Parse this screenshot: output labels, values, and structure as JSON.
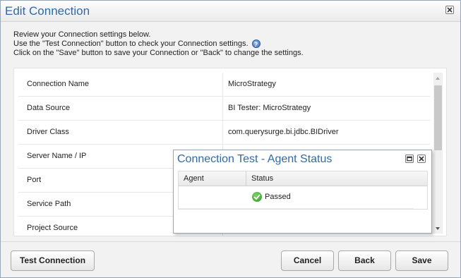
{
  "dialog": {
    "title": "Edit Connection",
    "intro": {
      "line1": "Review your Connection settings below.",
      "line2": "Use the \"Test Connection\" button to check your Connection settings.",
      "line3": "Click on the \"Save\" button to save your Connection or \"Back\" to change the settings."
    },
    "help_icon": "?",
    "settings": [
      {
        "label": "Connection Name",
        "value": "MicroStrategy"
      },
      {
        "label": "Data Source",
        "value": "BI Tester: MicroStrategy"
      },
      {
        "label": "Driver Class",
        "value": "com.querysurge.bi.jdbc.BIDriver"
      },
      {
        "label": "Server Name / IP",
        "value": ""
      },
      {
        "label": "Port",
        "value": ""
      },
      {
        "label": "Service Path",
        "value": ""
      },
      {
        "label": "Project Source",
        "value": ""
      }
    ],
    "buttons": {
      "test_connection": "Test Connection",
      "cancel": "Cancel",
      "back": "Back",
      "save": "Save"
    }
  },
  "popup": {
    "title": "Connection Test - Agent Status",
    "columns": {
      "agent": "Agent",
      "status": "Status"
    },
    "rows": [
      {
        "agent": "",
        "status": "Passed",
        "status_icon": "check-circle-icon"
      }
    ]
  },
  "colors": {
    "title_blue": "#2f6aa6",
    "success_green": "#2f9a2a"
  }
}
